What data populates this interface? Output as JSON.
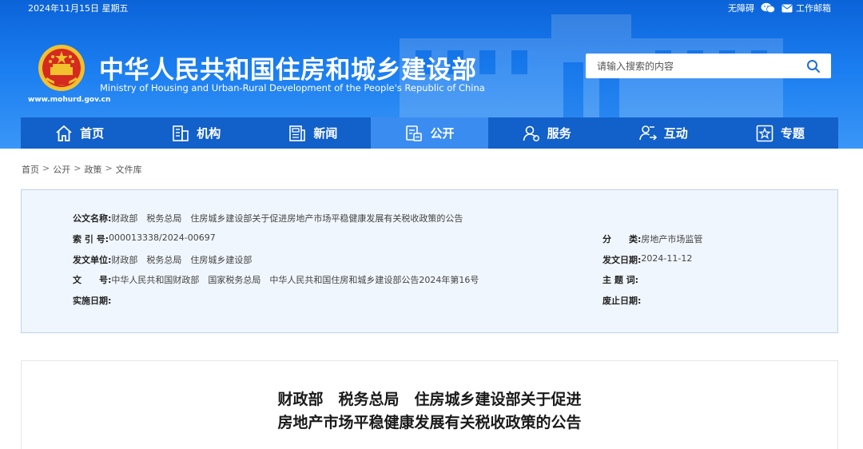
{
  "topbar": {
    "date": "2024年11月15日 星期五",
    "accessibility_label": "无障碍",
    "email_label": "工作邮箱"
  },
  "site": {
    "title": "中华人民共和国住房和城乡建设部",
    "subtitle": "Ministry of Housing and Urban-Rural Development of the People's Republic of China",
    "url": "www.mohurd.gov.cn"
  },
  "search": {
    "placeholder": "请输入搜索的内容"
  },
  "nav": {
    "items": [
      {
        "label": "首页",
        "icon": "home-icon"
      },
      {
        "label": "机构",
        "icon": "building-icon"
      },
      {
        "label": "新闻",
        "icon": "news-icon"
      },
      {
        "label": "公开",
        "icon": "document-icon",
        "active": true
      },
      {
        "label": "服务",
        "icon": "service-icon"
      },
      {
        "label": "互动",
        "icon": "interaction-icon"
      },
      {
        "label": "专题",
        "icon": "star-icon"
      }
    ]
  },
  "breadcrumb": {
    "items": [
      "首页",
      "公开",
      "政策",
      "文件库"
    ],
    "separator": ">"
  },
  "info": {
    "doc_name_label": "公文名称:",
    "doc_name_value": "财政部　税务总局　住房城乡建设部关于促进房地产市场平稳健康发展有关税收政策的公告",
    "index_label": "索 引 号:",
    "index_value": "000013338/2024-00697",
    "category_label": "分　　类:",
    "category_value": "房地产市场监管",
    "issuer_label": "发文单位:",
    "issuer_value": "财政部　税务总局　住房城乡建设部",
    "issue_date_label": "发文日期:",
    "issue_date_value": "2024-11-12",
    "doc_no_label": "文　　号:",
    "doc_no_value": "中华人民共和国财政部　国家税务总局　中华人民共和国住房和城乡建设部公告2024年第16号",
    "subject_label": "主 题 词:",
    "subject_value": "",
    "effective_label": "实施日期:",
    "effective_value": "",
    "expiry_label": "废止日期:",
    "expiry_value": ""
  },
  "article": {
    "title_line1": "财政部　税务总局　住房城乡建设部关于促进",
    "title_line2": "房地产市场平稳健康发展有关税收政策的公告"
  },
  "colors": {
    "header_blue": "#1a7df0",
    "nav_blue": "#1260c9",
    "nav_active": "#3b8cf0",
    "info_bg": "#f0f6fd",
    "info_border": "#b9d4f0",
    "emblem_red": "#d42a1f",
    "emblem_gold": "#f2c12e"
  }
}
